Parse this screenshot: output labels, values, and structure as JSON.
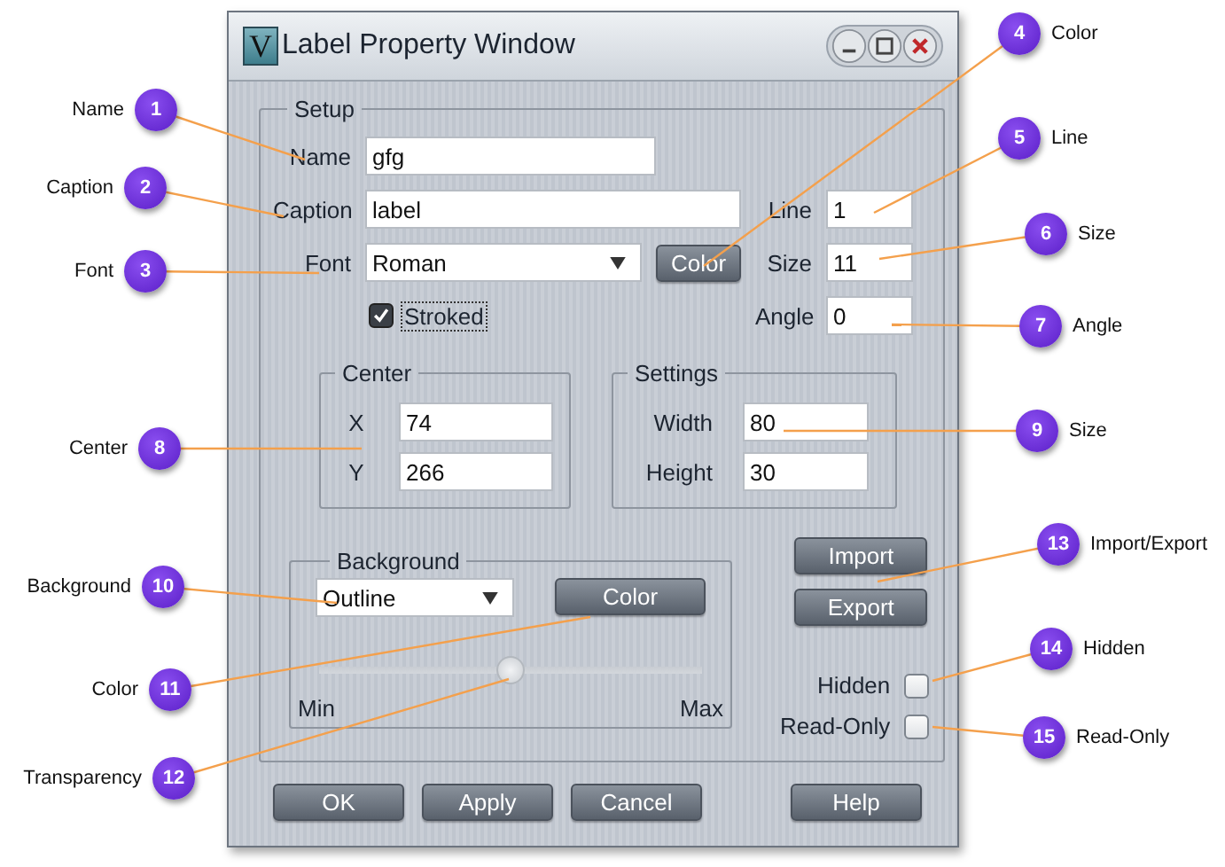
{
  "window": {
    "title": "Label Property Window",
    "icon_letter": "V"
  },
  "setup": {
    "title": "Setup",
    "name": {
      "label": "Name",
      "value": "gfg"
    },
    "caption": {
      "label": "Caption",
      "value": "label"
    },
    "font": {
      "label": "Font",
      "value": "Roman",
      "button": "Color"
    },
    "stroked": {
      "label": "Stroked",
      "checked": true
    },
    "line": {
      "label": "Line",
      "value": "1"
    },
    "size": {
      "label": "Size",
      "value": "11"
    },
    "angle": {
      "label": "Angle",
      "value": "0"
    },
    "center": {
      "title": "Center",
      "x": {
        "label": "X",
        "value": "74"
      },
      "y": {
        "label": "Y",
        "value": "266"
      }
    },
    "settings": {
      "title": "Settings",
      "width": {
        "label": "Width",
        "value": "80"
      },
      "height": {
        "label": "Height",
        "value": "30"
      }
    },
    "background": {
      "title": "Background",
      "style": "Outline",
      "button": "Color",
      "transparency": {
        "level": 0.5,
        "min": "Min",
        "max": "Max"
      }
    },
    "import_button": "Import",
    "export_button": "Export",
    "hidden": {
      "label": "Hidden",
      "checked": false
    },
    "read_only": {
      "label": "Read-Only",
      "checked": false
    }
  },
  "buttons": [
    "OK",
    "Apply",
    "Cancel",
    "Help"
  ],
  "callouts": [
    {
      "number": "1",
      "label": "Name"
    },
    {
      "number": "2",
      "label": "Caption"
    },
    {
      "number": "3",
      "label": "Font"
    },
    {
      "number": "4",
      "label": "Color"
    },
    {
      "number": "5",
      "label": "Line"
    },
    {
      "number": "6",
      "label": "Size"
    },
    {
      "number": "7",
      "label": "Angle"
    },
    {
      "number": "8",
      "label": "Center"
    },
    {
      "number": "9",
      "label": "Size"
    },
    {
      "number": "10",
      "label": "Background"
    },
    {
      "number": "11",
      "label": "Color"
    },
    {
      "number": "12",
      "label": "Transparency"
    },
    {
      "number": "13",
      "label": "Import/Export"
    },
    {
      "number": "14",
      "label": "Hidden"
    },
    {
      "number": "15",
      "label": "Read-Only"
    }
  ]
}
